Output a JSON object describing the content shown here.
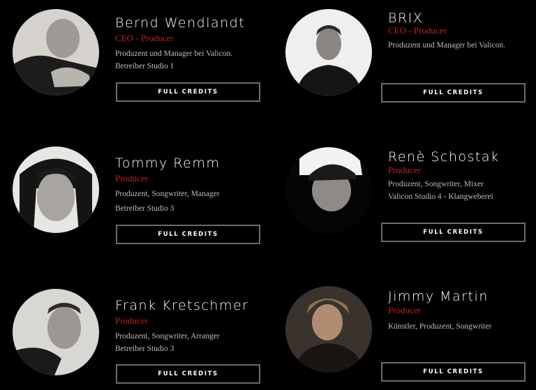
{
  "people": [
    {
      "name": "Bernd Wendlandt",
      "role": "CEO - Producer",
      "lines": [
        "Produzent und Manager bei Valicon.",
        "Betreiber Studio 1"
      ],
      "button": "FULL CREDITS"
    },
    {
      "name": "BRIX",
      "role": "CEO - Producer",
      "lines": [
        "Produzent und Manager bei Valicon."
      ],
      "button": "FULL CREDITS"
    },
    {
      "name": "Tommy Remm",
      "role": "Producer",
      "lines": [
        "Produzent, Songwriter, Manager",
        "Betreiber Studio 3"
      ],
      "button": "FULL CREDITS"
    },
    {
      "name": "Renè Schostak",
      "role": "Producer",
      "lines": [
        "Produzent, Songwriter, Mixer",
        "Valicon Studio 4 - Klangweberei"
      ],
      "button": "FULL CREDITS"
    },
    {
      "name": "Frank Kretschmer",
      "role": "Producer",
      "lines": [
        "Produzent, Songwriter, Arranger",
        "Betreiber Studio 3"
      ],
      "button": "FULL CREDITS"
    },
    {
      "name": "Jimmy Martin",
      "role": "Producer",
      "lines": [
        "Künstler, Produzent, Songwriter"
      ],
      "button": "FULL CREDITS"
    }
  ],
  "colors": {
    "background": "#000000",
    "role": "#c22222",
    "button_border": "#6c6c6c",
    "text": "#ffffff"
  }
}
